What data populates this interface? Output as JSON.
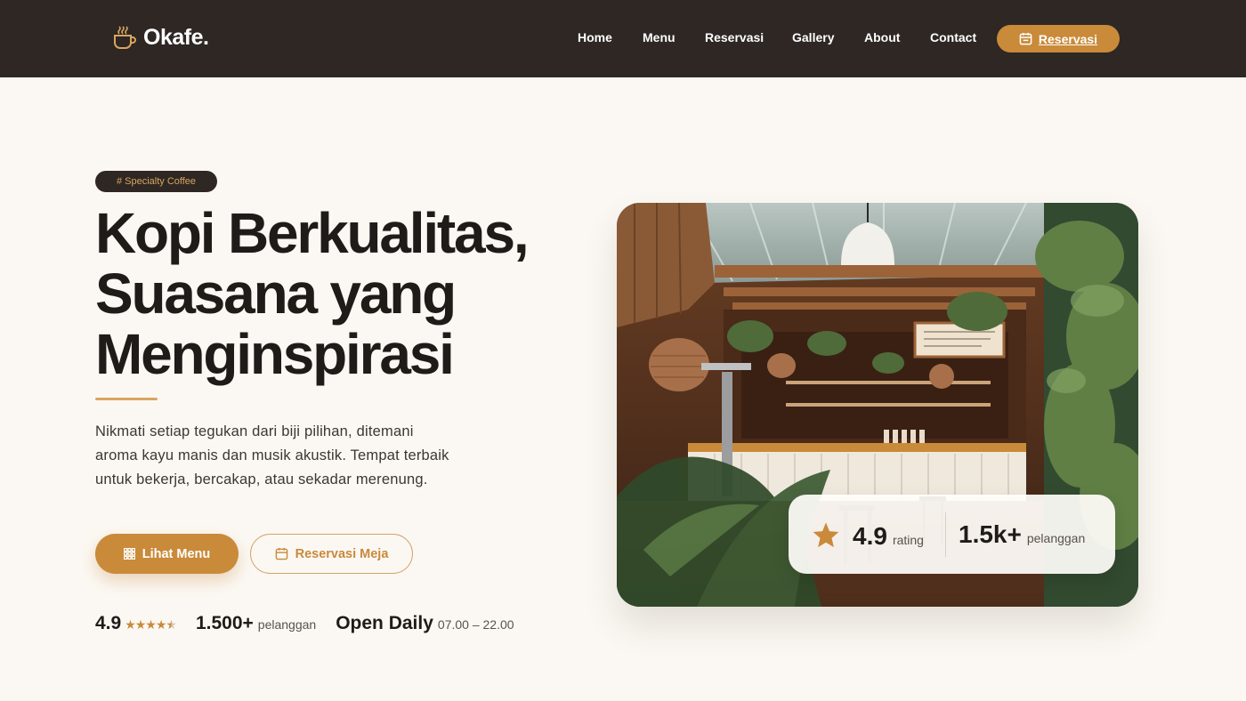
{
  "header": {
    "logo_text": "Okafe.",
    "logo_icon": "coffee-cup-icon",
    "nav_items": [
      {
        "label": "Home"
      },
      {
        "label": "Menu"
      },
      {
        "label": "Reservasi"
      },
      {
        "label": "Gallery"
      },
      {
        "label": "About"
      },
      {
        "label": "Contact"
      }
    ],
    "cta_label": "Reservasi",
    "cta_icon": "calendar-icon"
  },
  "hero": {
    "tag": "# Specialty Coffee",
    "title_lines": [
      "Kopi Berkualitas,",
      "Suasana yang",
      "Menginspirasi"
    ],
    "description": "Nikmati setiap tegukan dari biji pilihan, ditemani aroma kayu manis dan musik akustik. Tempat terbaik untuk bekerja, bercakap, atau sekadar merenung.",
    "primary_button": {
      "label": "Lihat Menu",
      "icon": "grid-icon"
    },
    "secondary_button": {
      "label": "Reservasi Meja",
      "icon": "calendar-icon"
    },
    "stats": {
      "rating_value": "4.9",
      "rating_stars": 4.5,
      "customers_value": "1.500+",
      "customers_label": "pelanggan",
      "open_label": "Open Daily",
      "open_hours": "07.00 – 22.00"
    }
  },
  "image_card": {
    "image_alt_icon": "cafe-interior-photo",
    "rating_value": "4.9",
    "rating_label": "rating",
    "customers_value": "1.5k+",
    "customers_label": "pelanggan",
    "star_icon": "star-icon"
  },
  "colors": {
    "header_bg": "#2e2724",
    "accent": "#c98a3a",
    "page_bg": "#fbf8f3",
    "text_dark": "#1f1b18"
  }
}
